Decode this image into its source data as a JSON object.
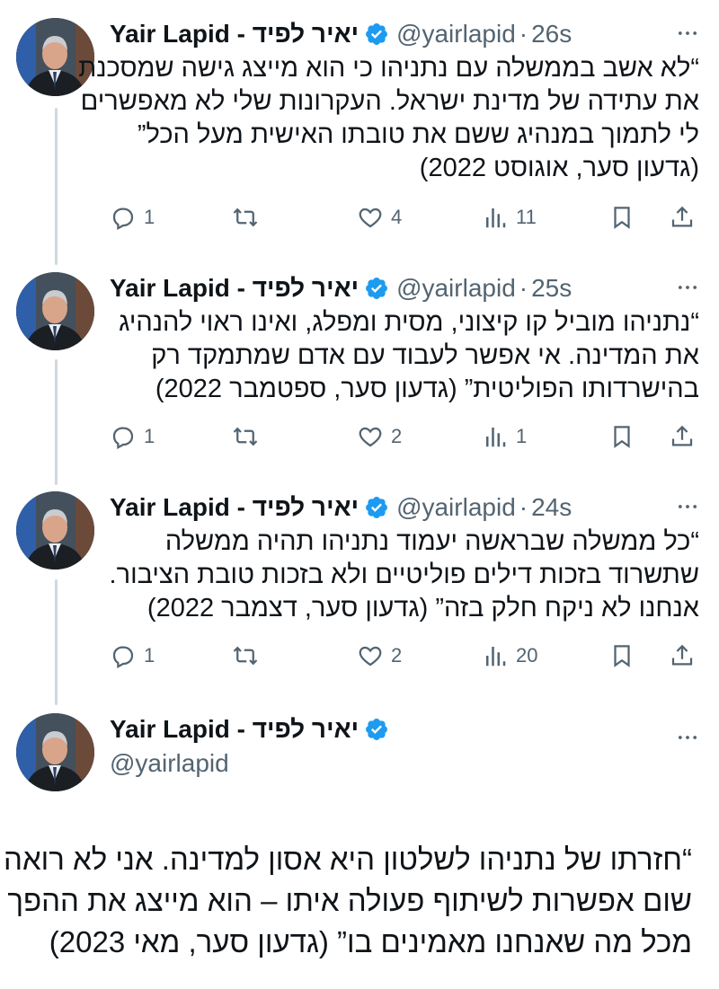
{
  "author": {
    "name": "Yair Lapid - יאיר לפיד",
    "handle": "@yairlapid"
  },
  "colors": {
    "verified": "#1d9bf0",
    "secondary_text": "#536471",
    "thread_line": "#cfd9de"
  },
  "tweets": [
    {
      "time": "26s",
      "lines": [
        "“לא אשב בממשלה עם נתניהו כי הוא מייצג גישה שמסכנת",
        "את עתידה של מדינת ישראל. העקרונות שלי לא מאפשרים",
        "לי לתמוך במנהיג ששם את טובתו האישית מעל הכל”",
        "(גדעון סער, אוגוסט 2022)"
      ],
      "replies": "1",
      "likes": "4",
      "views": "11"
    },
    {
      "time": "25s",
      "lines": [
        "“נתניהו מוביל קו קיצוני, מסית ומפלג, ואינו ראוי להנהיג",
        "את המדינה. אי אפשר לעבוד עם אדם שמתמקד רק",
        "בהישרדותו הפוליטית” (גדעון סער, ספטמבר 2022)"
      ],
      "replies": "1",
      "likes": "2",
      "views": "1"
    },
    {
      "time": "24s",
      "lines": [
        "“כל ממשלה שבראשה יעמוד נתניהו תהיה ממשלה",
        "שתשרוד בזכות דילים פוליטיים ולא בזכות טובת הציבור.",
        "אנחנו לא ניקח חלק בזה” (גדעון סער, דצמבר 2022)"
      ],
      "replies": "1",
      "likes": "2",
      "views": "20"
    }
  ],
  "main_tweet": {
    "lines": [
      "“חזרתו של נתניהו לשלטון היא אסון למדינה. אני לא רואה",
      "שום אפשרות לשיתוף פעולה איתו – הוא מייצג את ההפך",
      "מכל מה שאנחנו מאמינים בו” (גדעון סער, מאי 2023)"
    ]
  },
  "icons": {
    "verified": "verified-badge-icon",
    "more": "more-options-icon",
    "reply": "reply-icon",
    "retweet": "retweet-icon",
    "like": "heart-icon",
    "views": "views-bar-chart-icon",
    "bookmark": "bookmark-icon",
    "share": "share-icon"
  }
}
